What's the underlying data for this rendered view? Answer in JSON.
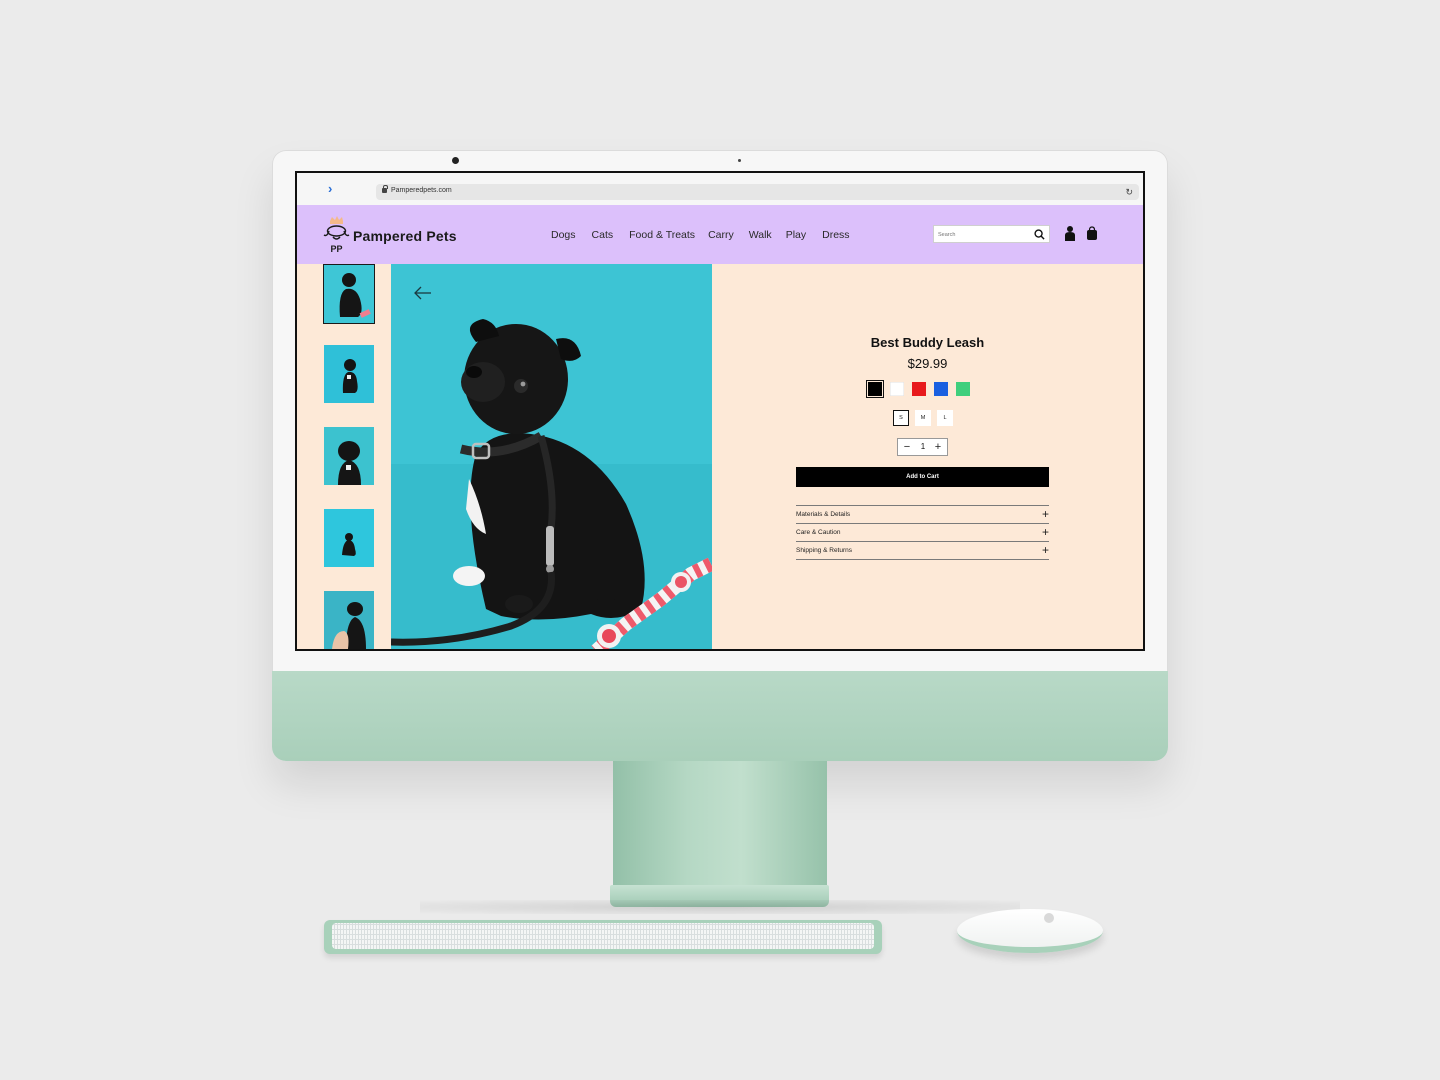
{
  "browser": {
    "url": "Pamperedpets.com"
  },
  "header": {
    "brand": "Pampered Pets",
    "logo_monogram": "PP",
    "nav": [
      "Dogs",
      "Cats",
      "Food & Treats",
      "Carry",
      "Walk",
      "Play",
      "Dress"
    ],
    "search_placeholder": "Search"
  },
  "product": {
    "title": "Best Buddy Leash",
    "price": "$29.99",
    "colors": [
      "#000000",
      "#ffffff",
      "#e8191c",
      "#1a5fe0",
      "#3fcf7d"
    ],
    "selected_color": "#000000",
    "sizes": [
      "S",
      "M",
      "L"
    ],
    "selected_size": "S",
    "quantity": "1",
    "add_to_cart_label": "Add to Cart",
    "accordion": [
      "Materials & Details",
      "Care & Caution",
      "Shipping & Returns"
    ]
  },
  "gallery": {
    "thumbnail_count": 5,
    "selected_index": 0
  },
  "theme": {
    "header_bg": "#dcc0fb",
    "page_bg": "#fde9d7",
    "image_bg": "#3ec6d6",
    "imac_color": "#b3d6c2"
  }
}
